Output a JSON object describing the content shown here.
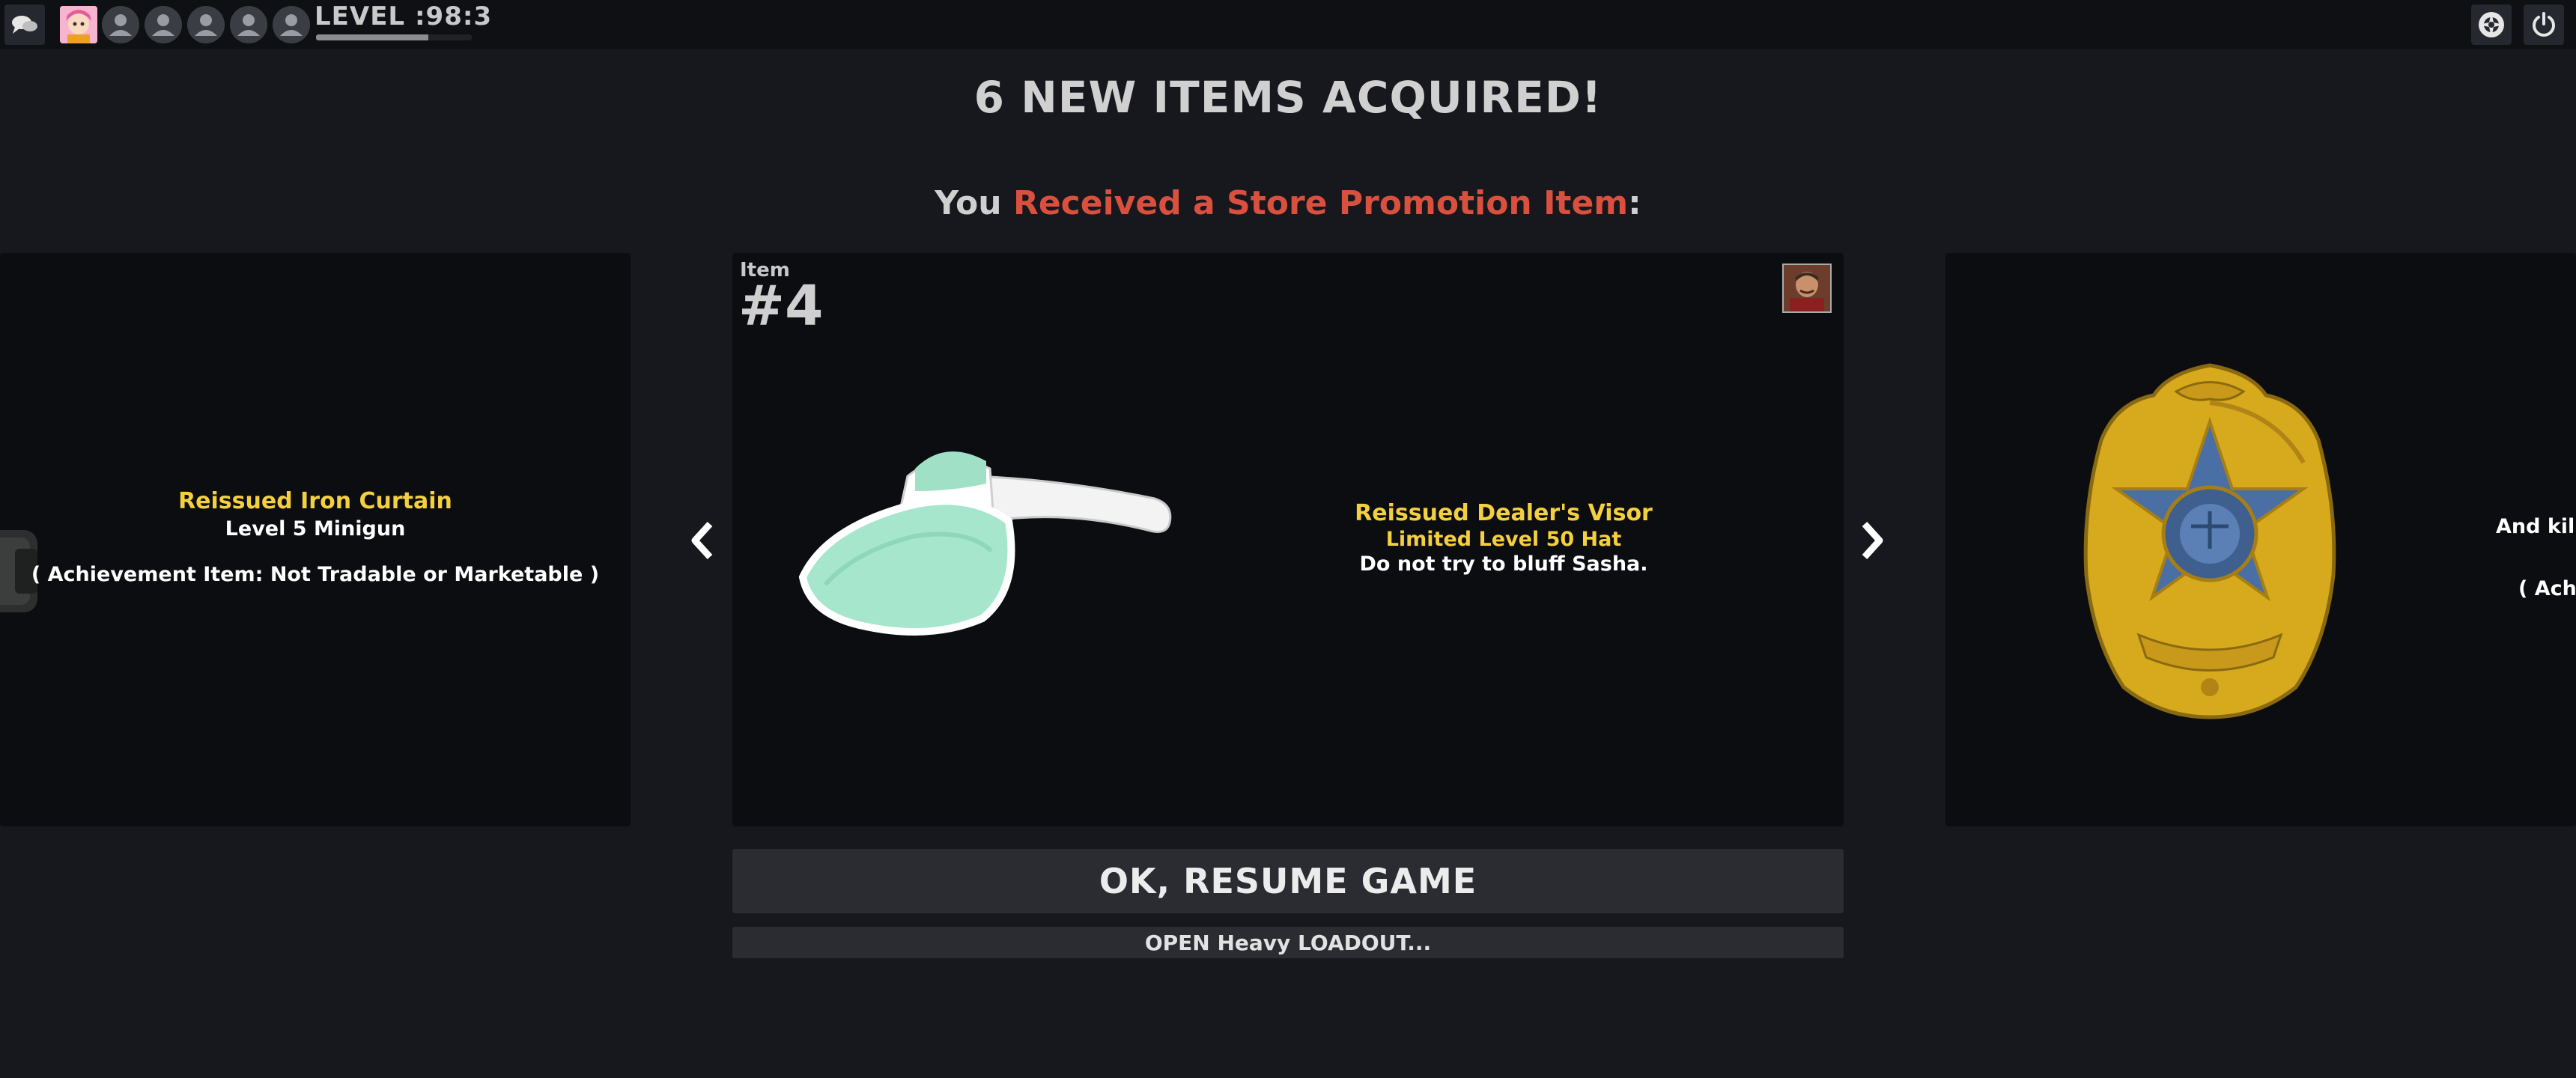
{
  "topbar": {
    "level_prefix": "LEVEL",
    "level_value": ":98:3",
    "level_progress": 0.72,
    "icons": [
      "chat-icon",
      "player-avatar",
      "friend-icon",
      "friend-icon",
      "friend-icon",
      "friend-icon",
      "friend-icon",
      "tf2-logo-icon",
      "power-icon"
    ]
  },
  "header": {
    "title": "6 NEW ITEMS ACQUIRED!",
    "sub_prefix": "You ",
    "sub_highlight": "Received a Store Promotion Item",
    "sub_suffix": ":"
  },
  "items": {
    "prev": {
      "name": "Reissued Iron Curtain",
      "type": "Level 5 Minigun",
      "note": "( Achievement Item: Not Tradable or Marketable )"
    },
    "current": {
      "label": "Item",
      "number": "#4",
      "name": "Reissued Dealer's Visor",
      "type": "Limited Level 50 Hat",
      "description": "Do not try to bluff Sasha."
    },
    "next": {
      "line1": "And kill, ",
      "line2": "( Achi"
    }
  },
  "buttons": {
    "resume": "OK, RESUME GAME",
    "loadout": "OPEN Heavy LOADOUT..."
  },
  "colors": {
    "background": "#16181d",
    "card": "#0c0d11",
    "item_name": "#f4d03f",
    "highlight_red": "#d9503f"
  }
}
